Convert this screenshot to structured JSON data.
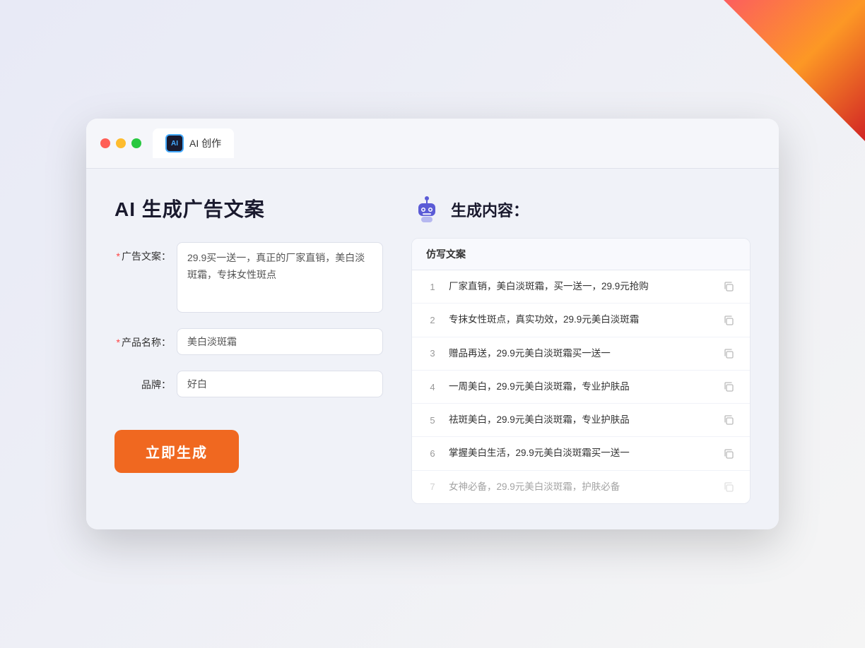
{
  "window": {
    "tab_label": "AI 创作",
    "dot_red": "red",
    "dot_yellow": "yellow",
    "dot_green": "green"
  },
  "page": {
    "title": "AI 生成广告文案",
    "result_title": "生成内容："
  },
  "form": {
    "ad_copy_label": "广告文案：",
    "ad_copy_required": "*",
    "ad_copy_value": "29.9买一送一，真正的厂家直销，美白淡斑霜，专抹女性斑点",
    "product_name_label": "产品名称：",
    "product_name_required": "*",
    "product_name_value": "美白淡斑霜",
    "brand_label": "品牌：",
    "brand_value": "好白",
    "generate_button": "立即生成"
  },
  "result": {
    "table_header": "仿写文案",
    "rows": [
      {
        "num": "1",
        "text": "厂家直销，美白淡斑霜，买一送一，29.9元抢购"
      },
      {
        "num": "2",
        "text": "专抹女性斑点，真实功效，29.9元美白淡斑霜"
      },
      {
        "num": "3",
        "text": "赠品再送，29.9元美白淡斑霜买一送一"
      },
      {
        "num": "4",
        "text": "一周美白，29.9元美白淡斑霜，专业护肤品"
      },
      {
        "num": "5",
        "text": "祛斑美白，29.9元美白淡斑霜，专业护肤品"
      },
      {
        "num": "6",
        "text": "掌握美白生活，29.9元美白淡斑霜买一送一"
      },
      {
        "num": "7",
        "text": "女神必备，29.9元美白淡斑霜，护肤必备"
      }
    ]
  }
}
